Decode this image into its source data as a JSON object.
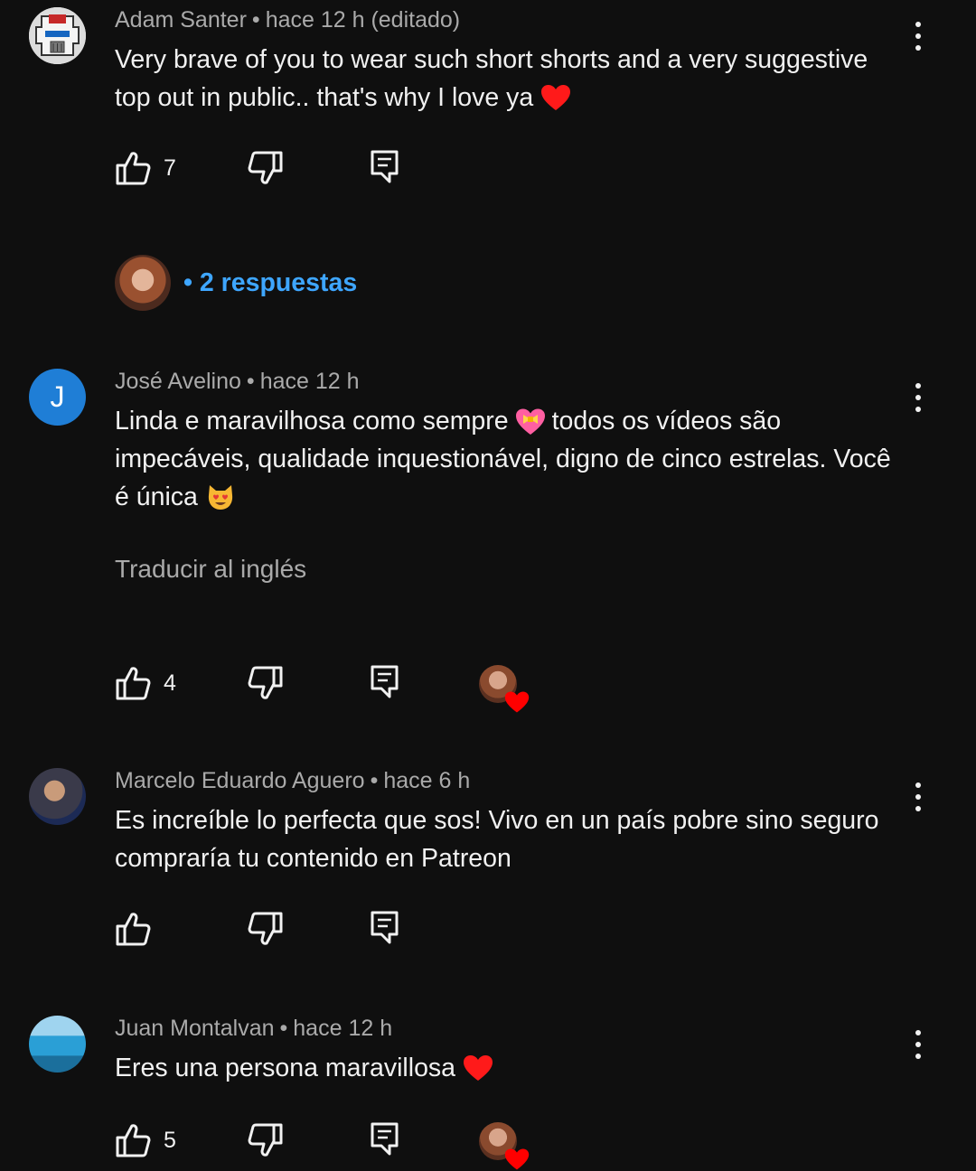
{
  "comments": [
    {
      "author": "Adam Santer",
      "time": "hace 12 h (editado)",
      "text_line1": "Very brave of you to wear such short shorts and a very suggestive",
      "text_line2": "top out in public.. that's why I love ya",
      "likes": "7",
      "avatar_icon": "robot-mask-avatar"
    },
    {
      "author": "José Avelino",
      "time": "hace 12 h",
      "avatar_letter": "J",
      "text_line1": "Linda e maravilhosa como sempre",
      "text_line1b": "todos os vídeos são",
      "text_line2": "impecáveis, qualidade inquestionável, digno de cinco estrelas. Você",
      "text_line3": "é única",
      "translate": "Traducir al inglés",
      "likes": "4",
      "creator_heart": true
    },
    {
      "author": "Marcelo Eduardo Aguero",
      "time": "hace 6 h",
      "text_line1": "Es increíble lo perfecta que sos! Vivo en un país pobre sino seguro",
      "text_line2": "compraría tu contenido en Patreon",
      "likes": ""
    },
    {
      "author": "Juan Montalvan",
      "time": "hace 12 h",
      "text_line1": "Eres una persona maravillosa",
      "likes": "5",
      "creator_heart": true
    }
  ],
  "replies": {
    "label": "• 2 respuestas"
  },
  "colors": {
    "background": "#0f0f0f",
    "link": "#3ea6ff",
    "secondary_text": "#aaaaaa",
    "heart": "#ff0000"
  }
}
